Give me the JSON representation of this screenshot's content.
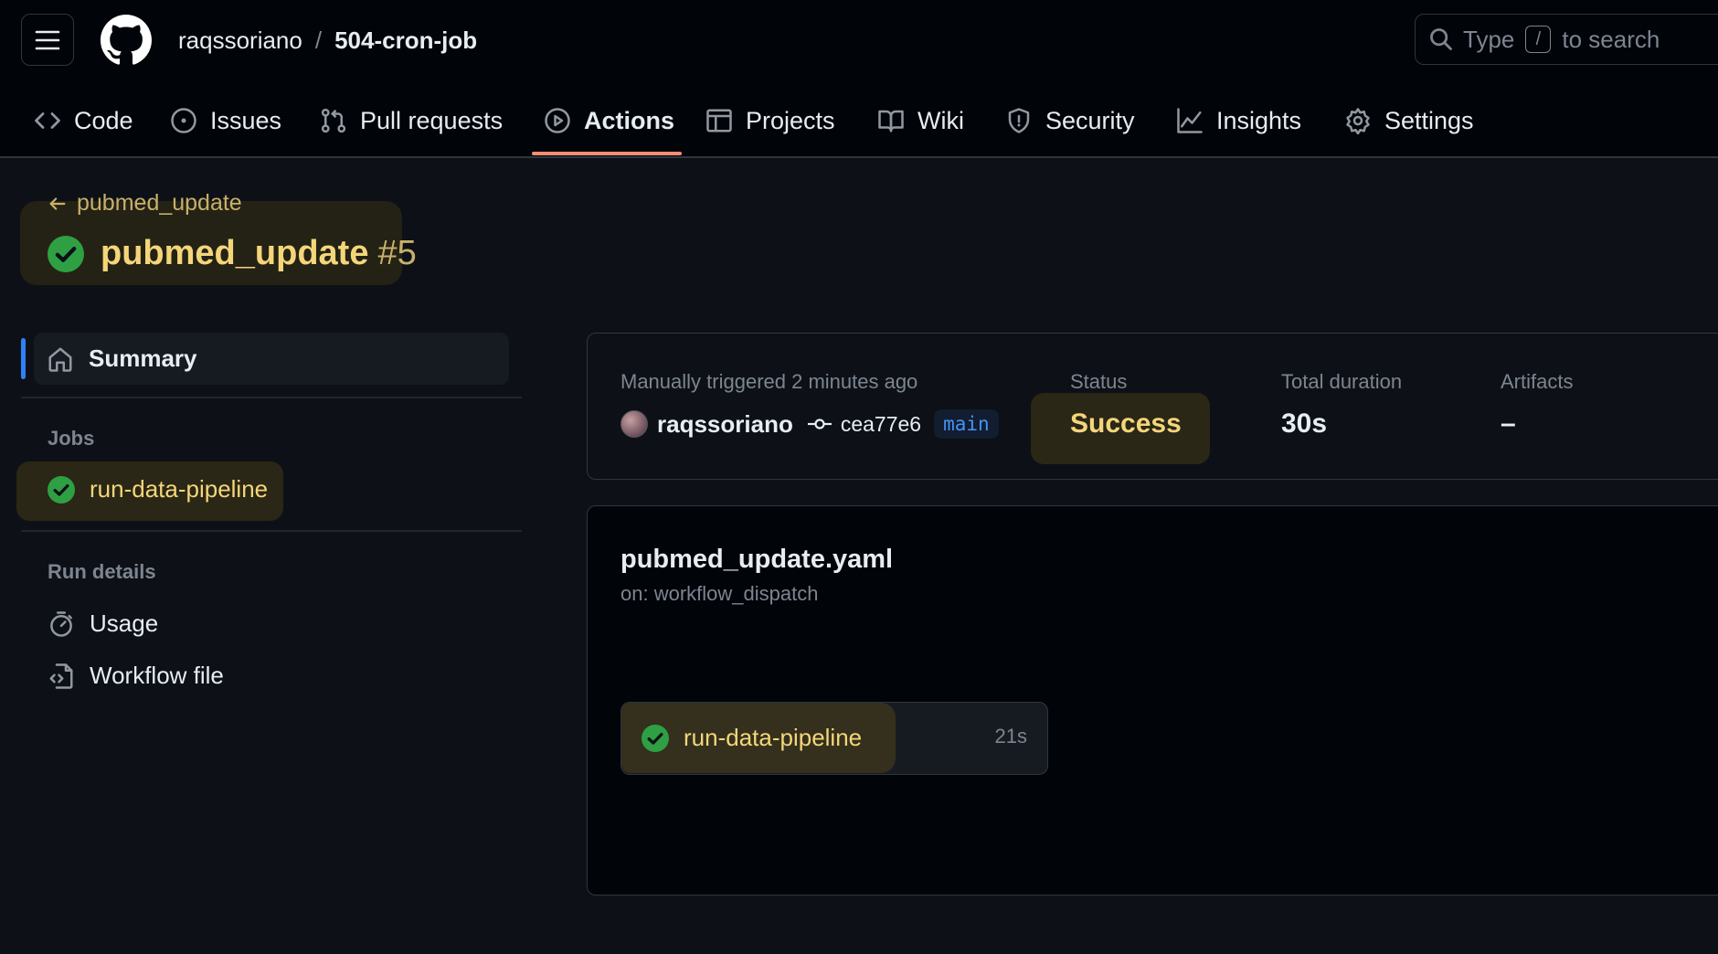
{
  "header": {
    "owner": "raqssoriano",
    "separator": "/",
    "repo": "504-cron-job",
    "search": {
      "prefix": "Type",
      "key": "/",
      "suffix": "to search"
    }
  },
  "nav": {
    "items": [
      {
        "label": "Code",
        "icon": "code-icon"
      },
      {
        "label": "Issues",
        "icon": "issue-icon"
      },
      {
        "label": "Pull requests",
        "icon": "pull-request-icon"
      },
      {
        "label": "Actions",
        "icon": "play-icon",
        "active": true
      },
      {
        "label": "Projects",
        "icon": "table-icon"
      },
      {
        "label": "Wiki",
        "icon": "book-icon"
      },
      {
        "label": "Security",
        "icon": "shield-icon"
      },
      {
        "label": "Insights",
        "icon": "graph-icon"
      },
      {
        "label": "Settings",
        "icon": "gear-icon"
      }
    ]
  },
  "run": {
    "back_label": "pubmed_update",
    "title": "pubmed_update",
    "number": "#5"
  },
  "sidebar": {
    "summary_label": "Summary",
    "jobs_heading": "Jobs",
    "jobs": [
      {
        "label": "run-data-pipeline",
        "status": "success"
      }
    ],
    "run_details_heading": "Run details",
    "details": [
      {
        "label": "Usage",
        "icon": "stopwatch-icon"
      },
      {
        "label": "Workflow file",
        "icon": "file-code-icon"
      }
    ]
  },
  "summary": {
    "trigger_text": "Manually triggered 2 minutes ago",
    "actor": "raqssoriano",
    "commit": "cea77e6",
    "branch": "main",
    "status_label": "Status",
    "status_value": "Success",
    "duration_label": "Total duration",
    "duration_value": "30s",
    "artifacts_label": "Artifacts",
    "artifacts_value": "–"
  },
  "workflow": {
    "file_name": "pubmed_update.yaml",
    "trigger": "on: workflow_dispatch",
    "job": {
      "label": "run-data-pipeline",
      "duration": "21s"
    }
  },
  "colors": {
    "background": "#0d1117",
    "header_bg": "#010409",
    "success_green": "#2ea043",
    "highlight_text": "#f4d67a",
    "active_underline": "#fd8c73",
    "branch_blue": "#4493f8",
    "selected_bar": "#2f81f7"
  }
}
